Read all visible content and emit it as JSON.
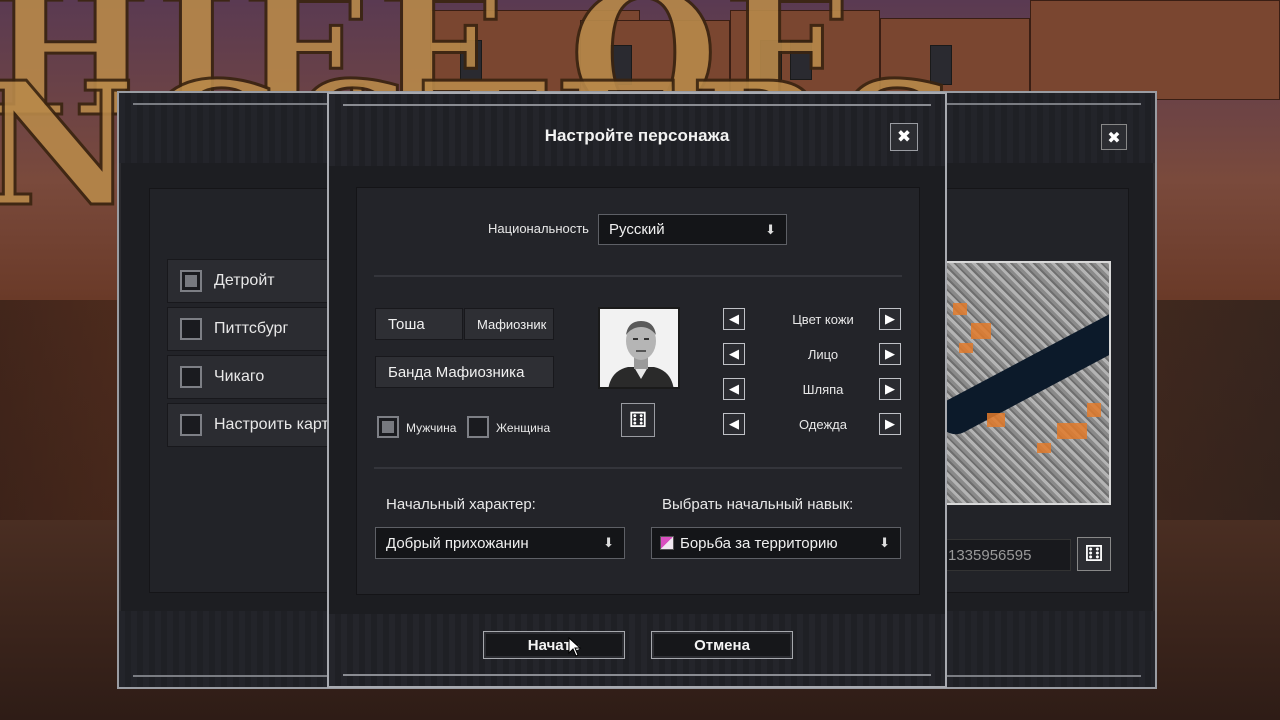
{
  "background": {
    "title_line1": "HIEF OF",
    "title_line2": "NGSTERS"
  },
  "city_select": {
    "items": [
      {
        "label": "Детройт",
        "checked": true
      },
      {
        "label": "Питтсбург",
        "checked": false
      },
      {
        "label": "Чикаго",
        "checked": false
      },
      {
        "label": "Настроить карту",
        "checked": false
      }
    ],
    "seed_value": "1335956595",
    "dice_icon": "dice-icon",
    "close_symbol": "✖"
  },
  "dialog": {
    "title": "Настройте персонажа",
    "close_symbol": "✖",
    "nationality": {
      "label": "Национальность",
      "value": "Русский",
      "arrow": "⬇"
    },
    "first_name": "Тоша",
    "last_name": "Мафиозник",
    "gang_name": "Банда Мафиозника",
    "gender": {
      "male_label": "Мужчина",
      "female_label": "Женщина",
      "selected": "male"
    },
    "appearance": {
      "left_arrow": "◀",
      "right_arrow": "▶",
      "options": [
        "Цвет кожи",
        "Лицо",
        "Шляпа",
        "Одежда"
      ]
    },
    "dice_symbol": "⚅",
    "starting_trait": {
      "label": "Начальный характер:",
      "value": "Добрый прихожанин",
      "arrow": "⬇"
    },
    "starting_skill": {
      "label": "Выбрать начальный навык:",
      "value": "Борьба за территорию",
      "arrow": "⬇"
    },
    "buttons": {
      "start": "Начать",
      "cancel": "Отмена"
    }
  },
  "colors": {
    "panel": "#232429",
    "border": "#a8aab0",
    "accent_orange": "#e27a2a"
  }
}
